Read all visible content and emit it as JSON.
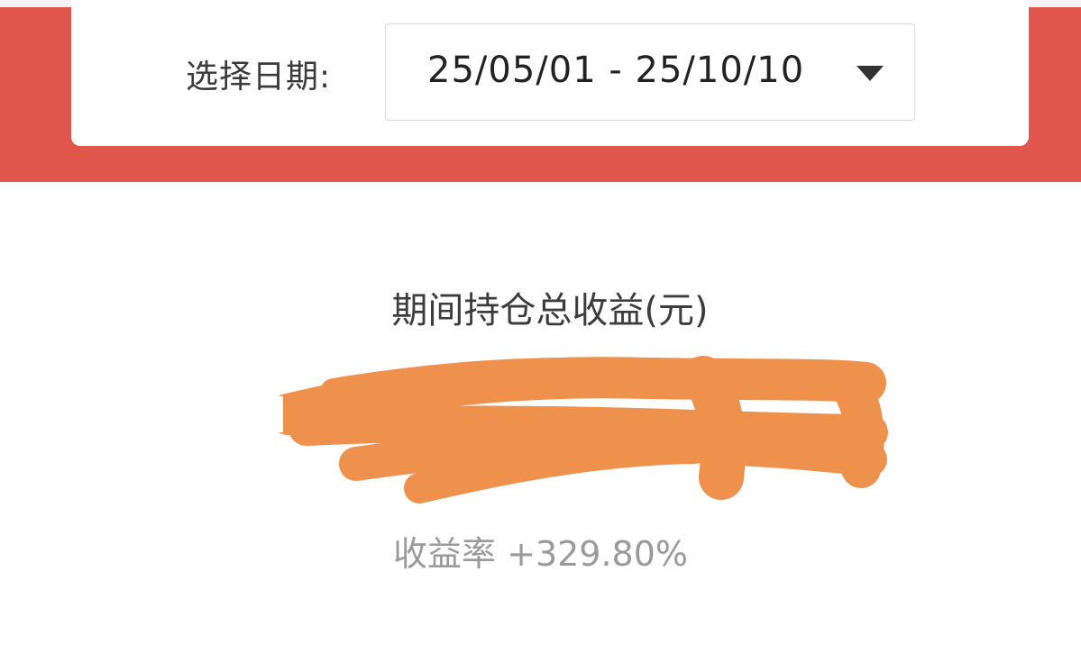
{
  "date_filter": {
    "label": "选择日期:",
    "value": "25/05/01 - 25/10/10"
  },
  "summary": {
    "title": "期间持仓总收益(元)",
    "amount": "",
    "rate_label": "收益率",
    "rate_value": "+329.80%"
  },
  "colors": {
    "header_red": "#e1574d",
    "redaction_orange": "#ee914d",
    "muted_text": "#9a9a9a"
  },
  "icons": {
    "dropdown": "caret-down-icon"
  }
}
